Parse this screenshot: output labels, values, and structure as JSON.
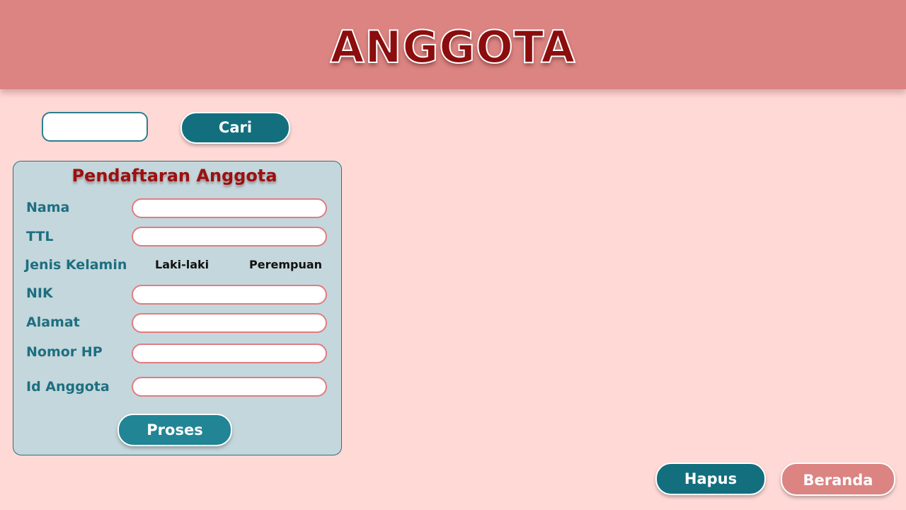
{
  "header": {
    "title": "ANGGOTA"
  },
  "search": {
    "value": "",
    "placeholder": "",
    "button_label": "Cari"
  },
  "form": {
    "title": "Pendaftaran Anggota",
    "fields": {
      "nama": {
        "label": "Nama",
        "value": ""
      },
      "ttl": {
        "label": "TTL",
        "value": ""
      },
      "jenis_kelamin": {
        "label": "Jenis Kelamin",
        "options": [
          "Laki-laki",
          "Perempuan"
        ]
      },
      "nik": {
        "label": "NIK",
        "value": ""
      },
      "alamat": {
        "label": "Alamat",
        "value": ""
      },
      "nomor_hp": {
        "label": "Nomor HP",
        "value": ""
      },
      "id_anggota": {
        "label": "Id Anggota",
        "value": ""
      }
    },
    "submit_label": "Proses"
  },
  "actions": {
    "delete_label": "Hapus",
    "home_label": "Beranda"
  },
  "colors": {
    "background": "#ffd9d6",
    "header": "#db8482",
    "title_red": "#8b0d0d",
    "teal": "#136f7e",
    "panel": "#c4d7dc"
  }
}
